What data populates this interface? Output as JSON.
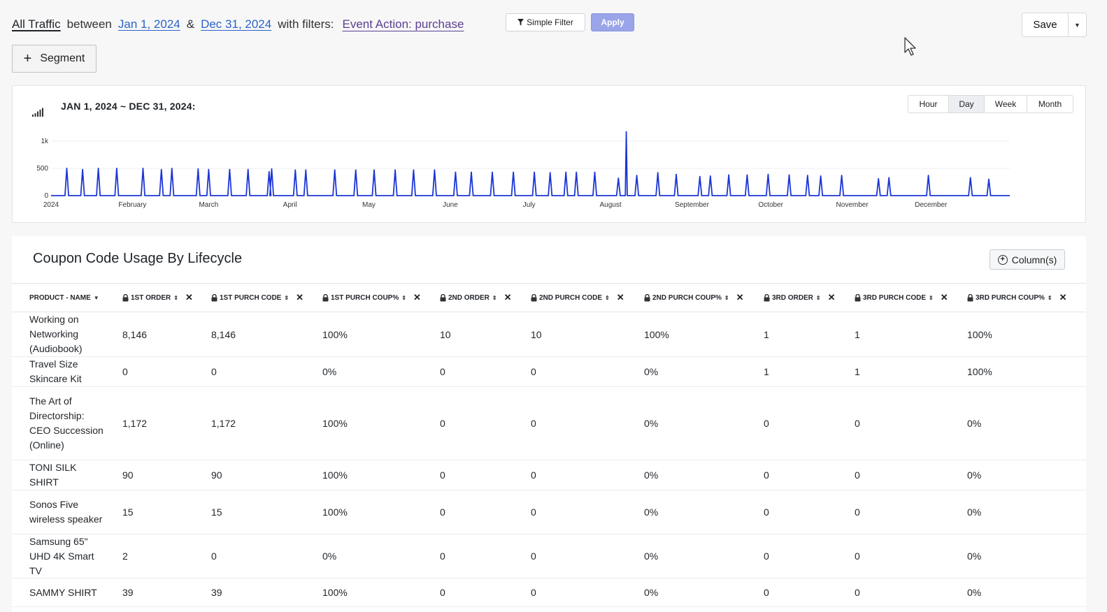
{
  "filterbar": {
    "segment_label": "All Traffic",
    "between": "between",
    "start_date": "Jan 1, 2024",
    "amp": "&",
    "end_date": "Dec 31, 2024",
    "with_filters": "with filters:",
    "filter_value": "Event Action: purchase"
  },
  "toolbar": {
    "simple_filter": "Simple Filter",
    "apply": "Apply",
    "save": "Save"
  },
  "segment_button": "Segment",
  "chart_panel": {
    "title": "JAN 1, 2024 ~ DEC 31, 2024:",
    "periods": [
      "Hour",
      "Day",
      "Week",
      "Month"
    ],
    "active_period": "Day"
  },
  "chart_data": {
    "type": "line",
    "title": "JAN 1, 2024 ~ DEC 31, 2024:",
    "xlabel": "",
    "ylabel": "",
    "ylim": [
      0,
      1000
    ],
    "y_ticks": [
      "0",
      "500",
      "1k"
    ],
    "x_tick_labels": [
      "2024",
      "February",
      "March",
      "April",
      "May",
      "June",
      "July",
      "August",
      "September",
      "October",
      "November",
      "December"
    ],
    "x_range": [
      "2024-01-01",
      "2024-12-31"
    ],
    "grid": true,
    "color": "#1c36d6",
    "series": [
      {
        "x": [
          "2024-01-07",
          "2024-01-13",
          "2024-01-19",
          "2024-01-26",
          "2024-02-05",
          "2024-02-12",
          "2024-02-16",
          "2024-02-26",
          "2024-03-01",
          "2024-03-09",
          "2024-03-16",
          "2024-03-24",
          "2024-03-25",
          "2024-04-03",
          "2024-04-07",
          "2024-04-18",
          "2024-04-26",
          "2024-05-03",
          "2024-05-11",
          "2024-05-18",
          "2024-05-26",
          "2024-06-03",
          "2024-06-09",
          "2024-06-17",
          "2024-06-25",
          "2024-07-03",
          "2024-07-09",
          "2024-07-15",
          "2024-07-19",
          "2024-07-26",
          "2024-08-04",
          "2024-08-07",
          "2024-08-11",
          "2024-08-19",
          "2024-08-26",
          "2024-09-04",
          "2024-09-08",
          "2024-09-15",
          "2024-09-22",
          "2024-09-30",
          "2024-10-08",
          "2024-10-15",
          "2024-10-20",
          "2024-10-28",
          "2024-11-11",
          "2024-11-15",
          "2024-11-30",
          "2024-12-16",
          "2024-12-23"
        ],
        "values": [
          500,
          480,
          500,
          500,
          500,
          480,
          500,
          490,
          480,
          480,
          480,
          440,
          490,
          470,
          470,
          470,
          470,
          470,
          470,
          470,
          470,
          430,
          430,
          430,
          430,
          430,
          420,
          430,
          430,
          430,
          320,
          1170,
          370,
          420,
          390,
          350,
          360,
          380,
          380,
          390,
          380,
          370,
          360,
          370,
          310,
          330,
          370,
          330,
          300
        ]
      }
    ]
  },
  "table": {
    "title": "Coupon Code Usage By Lifecycle",
    "columns_button": "Column(s)",
    "name_header": "PRODUCT - NAME",
    "headers": [
      "1ST ORDER",
      "1ST PURCH CODE",
      "1ST PURCH COUP%",
      "2ND ORDER",
      "2ND PURCH CODE",
      "2ND PURCH COUP%",
      "3RD ORDER",
      "3RD PURCH CODE",
      "3RD PURCH COUP%"
    ],
    "rows": [
      {
        "name": "Working on Networking (Audiobook)",
        "cells": [
          "8,146",
          "8,146",
          "100%",
          "10",
          "10",
          "100%",
          "1",
          "1",
          "100%"
        ]
      },
      {
        "name": "Travel Size Skincare Kit",
        "cells": [
          "0",
          "0",
          "0%",
          "0",
          "0",
          "0%",
          "1",
          "1",
          "100%"
        ]
      },
      {
        "name": "The Art of Directorship: CEO Succession (Online)",
        "cells": [
          "1,172",
          "1,172",
          "100%",
          "0",
          "0",
          "0%",
          "0",
          "0",
          "0%"
        ]
      },
      {
        "name": "TONI SILK SHIRT",
        "cells": [
          "90",
          "90",
          "100%",
          "0",
          "0",
          "0%",
          "0",
          "0",
          "0%"
        ]
      },
      {
        "name": "Sonos Five wireless speaker",
        "cells": [
          "15",
          "15",
          "100%",
          "0",
          "0",
          "0%",
          "0",
          "0",
          "0%"
        ]
      },
      {
        "name": "Samsung 65\" UHD 4K Smart TV",
        "cells": [
          "2",
          "0",
          "0%",
          "0",
          "0",
          "0%",
          "0",
          "0",
          "0%"
        ]
      },
      {
        "name": "SAMMY SHIRT",
        "cells": [
          "39",
          "39",
          "100%",
          "0",
          "0",
          "0%",
          "0",
          "0",
          "0%"
        ]
      }
    ]
  }
}
